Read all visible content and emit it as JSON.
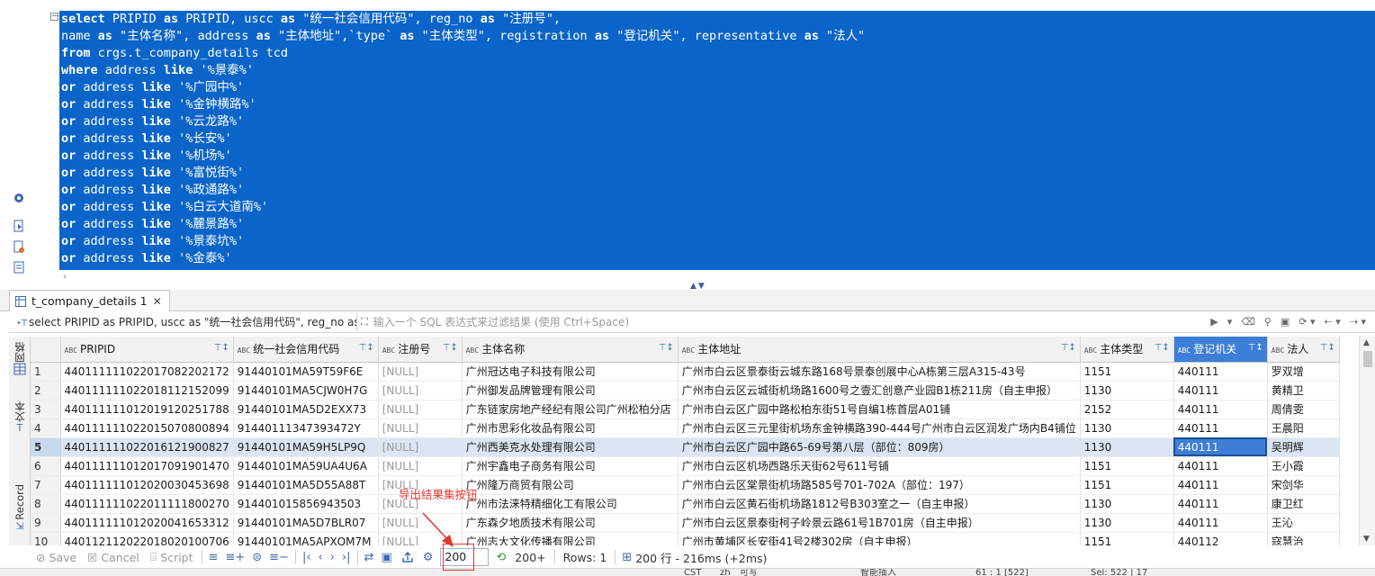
{
  "editor": {
    "lines": [
      [
        {
          "t": "select",
          "k": true
        },
        {
          "t": " PRIPID "
        },
        {
          "t": "as",
          "k": true
        },
        {
          "t": " PRIPID, uscc "
        },
        {
          "t": "as",
          "k": true
        },
        {
          "t": " \"统一社会信用代码\", reg_no "
        },
        {
          "t": "as",
          "k": true
        },
        {
          "t": " \"注册号\","
        }
      ],
      [
        {
          "t": "name "
        },
        {
          "t": "as",
          "k": true
        },
        {
          "t": " \"主体名称\", address "
        },
        {
          "t": "as",
          "k": true
        },
        {
          "t": " \"主体地址\",`type` "
        },
        {
          "t": "as",
          "k": true
        },
        {
          "t": " \"主体类型\", registration "
        },
        {
          "t": "as",
          "k": true
        },
        {
          "t": " \"登记机关\", representative "
        },
        {
          "t": "as",
          "k": true
        },
        {
          "t": " \"法人\""
        }
      ],
      [
        {
          "t": "from",
          "k": true
        },
        {
          "t": " crgs.t_company_details tcd"
        }
      ],
      [
        {
          "t": "where",
          "k": true
        },
        {
          "t": " address "
        },
        {
          "t": "like",
          "k": true
        },
        {
          "t": " '%景泰%'"
        }
      ],
      [
        {
          "t": "or",
          "k": true
        },
        {
          "t": " address "
        },
        {
          "t": "like",
          "k": true
        },
        {
          "t": " '%广园中%'"
        }
      ],
      [
        {
          "t": "or",
          "k": true
        },
        {
          "t": " address "
        },
        {
          "t": "like",
          "k": true
        },
        {
          "t": " '%金钟横路%'"
        }
      ],
      [
        {
          "t": "or",
          "k": true
        },
        {
          "t": " address "
        },
        {
          "t": "like",
          "k": true
        },
        {
          "t": " '%云龙路%'"
        }
      ],
      [
        {
          "t": "or",
          "k": true
        },
        {
          "t": " address "
        },
        {
          "t": "like",
          "k": true
        },
        {
          "t": " '%长安%'"
        }
      ],
      [
        {
          "t": "or",
          "k": true
        },
        {
          "t": " address "
        },
        {
          "t": "like",
          "k": true
        },
        {
          "t": " '%机场%'"
        }
      ],
      [
        {
          "t": "or",
          "k": true
        },
        {
          "t": " address "
        },
        {
          "t": "like",
          "k": true
        },
        {
          "t": " '%富悦街%'"
        }
      ],
      [
        {
          "t": "or",
          "k": true
        },
        {
          "t": " address "
        },
        {
          "t": "like",
          "k": true
        },
        {
          "t": " '%政通路%'"
        }
      ],
      [
        {
          "t": "or",
          "k": true
        },
        {
          "t": " address "
        },
        {
          "t": "like",
          "k": true
        },
        {
          "t": " '%白云大道南%'"
        }
      ],
      [
        {
          "t": "or",
          "k": true
        },
        {
          "t": " address "
        },
        {
          "t": "like",
          "k": true
        },
        {
          "t": " '%麓景路%'"
        }
      ],
      [
        {
          "t": "or",
          "k": true
        },
        {
          "t": " address "
        },
        {
          "t": "like",
          "k": true
        },
        {
          "t": " '%景泰坑%'"
        }
      ],
      [
        {
          "t": "or",
          "k": true
        },
        {
          "t": " address "
        },
        {
          "t": "like",
          "k": true
        },
        {
          "t": " '%金泰%'"
        }
      ]
    ],
    "selection_color": "#0a64c9"
  },
  "result_tab": {
    "label": "t_company_details 1",
    "close": "✕"
  },
  "filter_bar": {
    "current_sql": "select PRIPID as PRIPID, uscc as \"统一社会信用代码\", reg_no as",
    "placeholder": "输入一个 SQL 表达式来过滤结果 (使用 Ctrl+Space)"
  },
  "side_tabs": {
    "grid": "网格",
    "text": "文本",
    "record": "Record"
  },
  "grid": {
    "columns": [
      {
        "label": "PRIPID",
        "type": "ABC"
      },
      {
        "label": "统一社会信用代码",
        "type": "ABC"
      },
      {
        "label": "注册号",
        "type": "ABC"
      },
      {
        "label": "主体名称",
        "type": "ABC"
      },
      {
        "label": "主体地址",
        "type": "ABC"
      },
      {
        "label": "主体类型",
        "type": "ABC"
      },
      {
        "label": "登记机关",
        "type": "ABC"
      },
      {
        "label": "法人",
        "type": "ABC"
      }
    ],
    "selected_column": 6,
    "highlight_row": 4,
    "active_cell": {
      "row": 4,
      "col": 6
    },
    "rows": [
      [
        "1",
        "440111111022017082202172",
        "91440101MA59T59F6E",
        "[NULL]",
        "广州冠达电子科技有限公司",
        "广州市白云区景泰街云城东路168号景泰创展中心A栋第三层A315-43号",
        "1151",
        "440111",
        "罗双增"
      ],
      [
        "2",
        "440111111022018112152099",
        "91440101MA5CJW0H7G",
        "[NULL]",
        "广州御发品牌管理有限公司",
        "广州市白云区云城街机场路1600号之壹汇创意产业园B1栋211房（自主申报）",
        "1130",
        "440111",
        "黄精卫"
      ],
      [
        "3",
        "440111111012019120251788",
        "91440101MA5D2EXX73",
        "[NULL]",
        "广东链家房地产经纪有限公司广州松柏分店",
        "广州市白云区广园中路松柏东街51号自编1栋首层A01铺",
        "2152",
        "440111",
        "周倩雯"
      ],
      [
        "4",
        "440111111022015070800894",
        "91440111347393472Y",
        "[NULL]",
        "广州市思彩化妆品有限公司",
        "广州市白云区三元里街机场东金钟横路390-444号广州市白云区润发广场内B4铺位",
        "1130",
        "440111",
        "王晨阳"
      ],
      [
        "5",
        "440111111022016121900827",
        "91440101MA59H5LP9Q",
        "[NULL]",
        "广州西美克水处理有限公司",
        "广州市白云区广园中路65-69号第八层（部位：809房）",
        "1130",
        "440111",
        "吴明辉"
      ],
      [
        "6",
        "440111111012017091901470",
        "91440101MA59UA4U6A",
        "[NULL]",
        "广州宇鑫电子商务有限公司",
        "广州市白云区机场西路乐天街62号611号铺",
        "1151",
        "440111",
        "王小霞"
      ],
      [
        "7",
        "440111111012020030453698",
        "91440101MA5D55A88T",
        "[NULL]",
        "广州隆万商贸有限公司",
        "广州市白云区棠景街机场路585号701-702A（部位：197）",
        "1151",
        "440111",
        "宋剑华"
      ],
      [
        "8",
        "440111111022011111800270",
        "914401015856943503",
        "[NULL]",
        "广州市法涞特精细化工有限公司",
        "广州市白云区黄石街机场路1812号B303室之一（自主申报）",
        "1130",
        "440111",
        "康卫红"
      ],
      [
        "9",
        "440111111012020041653312",
        "91440101MA5D7BLR07",
        "[NULL]",
        "广东森夕地质技术有限公司",
        "广州市白云区景泰街柯子岭景云路61号1B701房（自主申报）",
        "1130",
        "440111",
        "王沁"
      ],
      [
        "10",
        "440112112022018020100706",
        "91440101MA5APXQM7M",
        "[NULL]",
        "广州志大文化传播有限公司",
        "广州市黄埔区长安街41号2楼302房（自主申报）",
        "1151",
        "440112",
        "寇慧治"
      ]
    ]
  },
  "bottom_bar": {
    "save": "Save",
    "cancel": "Cancel",
    "script": "Script",
    "fetch_size": "200",
    "fetch_more": "200+",
    "rows_label": "Rows: 1",
    "summary": "200 行 - 216ms (+2ms)"
  },
  "annotation": {
    "text": "导出结果集按钮",
    "color": "#e23a2f"
  },
  "status_bar": {
    "tz": "CST",
    "locale": "zh",
    "mode": "可写",
    "insert": "智能插入",
    "pos": "61 : 1 [522]",
    "sel": "Sel: 522 | 17"
  }
}
